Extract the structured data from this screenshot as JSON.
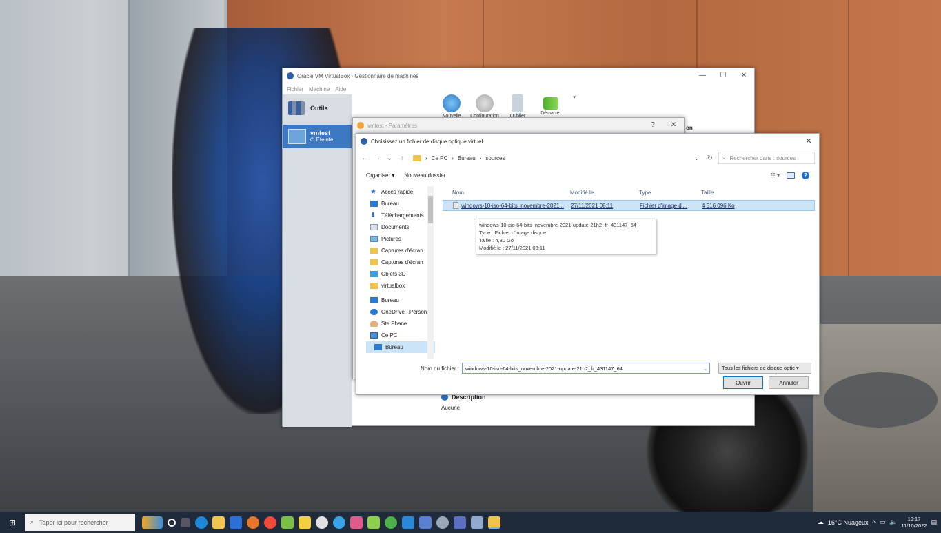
{
  "vbox": {
    "title": "Oracle VM VirtualBox - Gestionnaire de machines",
    "menu": [
      "Fichier",
      "Machine",
      "Aide"
    ],
    "tools_label": "Outils",
    "vm_name": "vmtest",
    "vm_state": "Éteinte",
    "toolbar": [
      {
        "label": "Nouvelle",
        "icon": "new-icon"
      },
      {
        "label": "Configuration",
        "icon": "gear-icon"
      },
      {
        "label": "Oublier",
        "icon": "arrow-down-icon"
      },
      {
        "label": "Démarrer",
        "icon": "start-arrow-icon"
      }
    ],
    "header_fragment": "on",
    "description_title": "Description",
    "description_value": "Aucune"
  },
  "settings": {
    "title": "vmtest - Paramètres",
    "help": "?",
    "close": "✕"
  },
  "dialog": {
    "title": "Choisissez un fichier de disque optique virtuel",
    "breadcrumb": [
      "Ce PC",
      "Bureau",
      "sources"
    ],
    "search_placeholder": "Rechercher dans : sources",
    "organize": "Organiser ▾",
    "new_folder": "Nouveau dossier",
    "nav_items": [
      {
        "label": "Accès rapide",
        "icon": "star-icon"
      },
      {
        "label": "Bureau",
        "icon": "desktop-folder-icon",
        "pin": "📌"
      },
      {
        "label": "Téléchargements",
        "icon": "download-icon",
        "pin": "📌"
      },
      {
        "label": "Documents",
        "icon": "documents-icon",
        "pin": "📌"
      },
      {
        "label": "Pictures",
        "icon": "pictures-icon",
        "pin": "📌"
      },
      {
        "label": "Captures d'écran",
        "icon": "folder-icon"
      },
      {
        "label": "Captures d'écran",
        "icon": "folder-icon"
      },
      {
        "label": "Objets 3D",
        "icon": "objects3d-icon"
      },
      {
        "label": "virtualbox",
        "icon": "folder-icon"
      },
      {
        "label": "Bureau",
        "icon": "desktop-folder-icon"
      },
      {
        "label": "OneDrive - Personal",
        "icon": "onedrive-icon"
      },
      {
        "label": "Ste Phane",
        "icon": "user-icon"
      },
      {
        "label": "Ce PC",
        "icon": "computer-icon"
      },
      {
        "label": "Bureau",
        "icon": "desktop-folder-icon"
      }
    ],
    "columns": [
      "Nom",
      "Modifié le",
      "Type",
      "Taille"
    ],
    "files": [
      {
        "name": "windows-10-iso-64-bits_novembre-2021...",
        "modified": "27/11/2021 08:11",
        "type": "Fichier d'image di...",
        "size": "4 516 096 Ko"
      }
    ],
    "tooltip": [
      "windows-10-iso-64-bits_novembre-2021-update-21h2_fr_431147_64",
      "Type : Fichier d'image disque",
      "Taille : 4,30 Go",
      "Modifié le : 27/11/2021 08:11"
    ],
    "filename_label": "Nom du fichier :",
    "filename_value": "windows-10-iso-64-bits_novembre-2021-update-21h2_fr_431147_64",
    "filter_value": "Tous les fichiers de disque optic ▾",
    "open_label": "Ouvrir",
    "cancel_label": "Annuler"
  },
  "taskbar": {
    "search_placeholder": "Taper ici pour rechercher",
    "weather": "16°C Nuageux",
    "time": "19:17",
    "date": "11/10/2022"
  },
  "colors": {
    "accent": "#0078d7",
    "selection": "#cce4f7",
    "vm_selected": "#3d78c2",
    "taskbar": "#1f2a3a"
  }
}
